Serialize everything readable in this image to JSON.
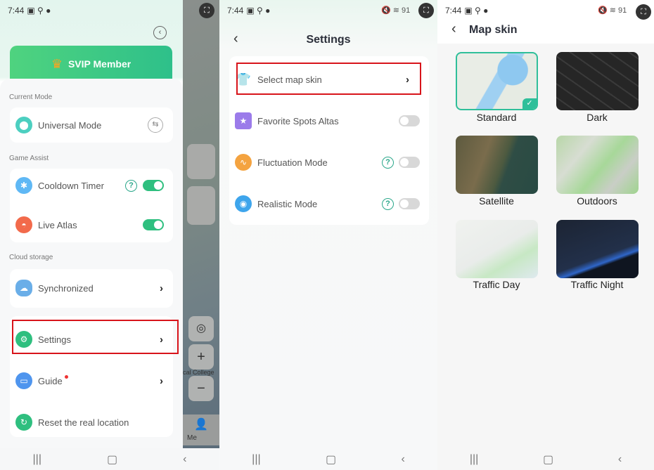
{
  "status": {
    "time": "7:44",
    "battery": "91"
  },
  "screen1": {
    "svip_label": "SVIP Member",
    "sections": {
      "current_mode": "Current Mode",
      "game_assist": "Game Assist",
      "cloud_storage": "Cloud storage"
    },
    "items": {
      "universal_mode": "Universal Mode",
      "cooldown_timer": "Cooldown Timer",
      "live_atlas": "Live Atlas",
      "synchronized": "Synchronized",
      "settings": "Settings",
      "guide": "Guide",
      "reset": "Reset the real location"
    },
    "toggles": {
      "cooldown_timer": true,
      "live_atlas": true
    },
    "map_me_label": "Me",
    "map_text": "cal College"
  },
  "screen2": {
    "title": "Settings",
    "items": [
      {
        "label": "Select map skin",
        "type": "link"
      },
      {
        "label": "Favorite Spots Altas",
        "type": "toggle",
        "on": false
      },
      {
        "label": "Fluctuation Mode",
        "type": "toggle",
        "on": false,
        "help": true
      },
      {
        "label": "Realistic Mode",
        "type": "toggle",
        "on": false,
        "help": true
      }
    ]
  },
  "screen3": {
    "title": "Map skin",
    "skins": [
      {
        "label": "Standard",
        "selected": true
      },
      {
        "label": "Dark",
        "selected": false
      },
      {
        "label": "Satellite",
        "selected": false
      },
      {
        "label": "Outdoors",
        "selected": false
      },
      {
        "label": "Traffic Day",
        "selected": false
      },
      {
        "label": "Traffic Night",
        "selected": false
      }
    ]
  },
  "colors": {
    "accent": "#2fbf7f",
    "highlight": "#d8141b"
  }
}
